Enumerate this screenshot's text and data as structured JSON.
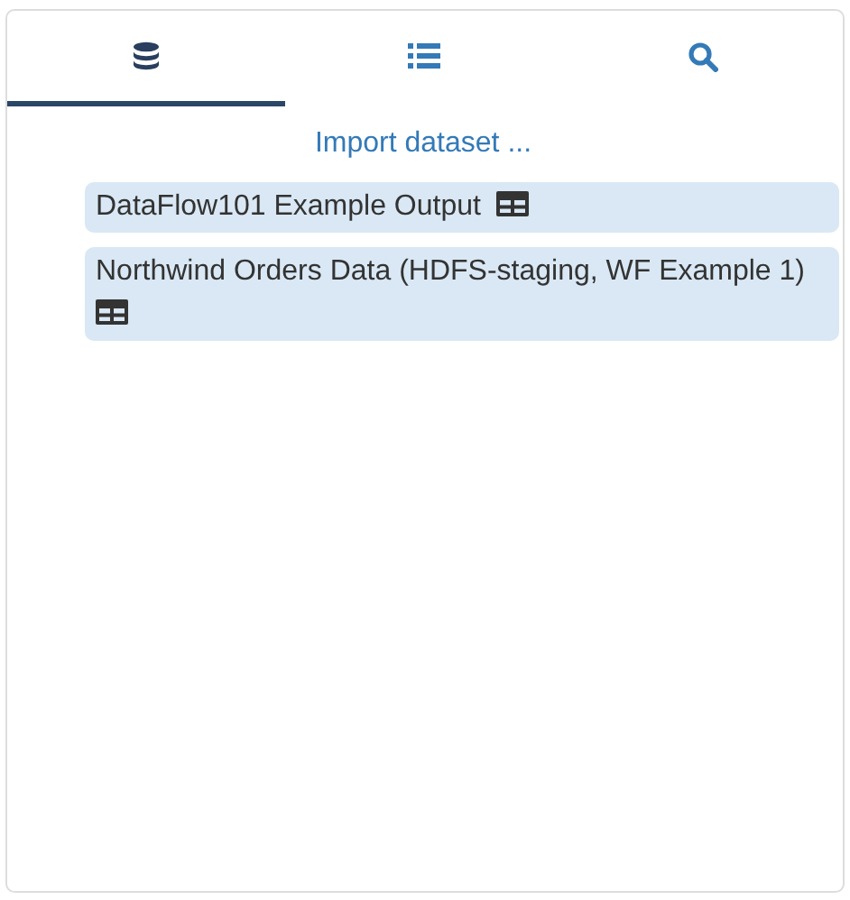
{
  "tabs": [
    {
      "kind": "database",
      "selected": true
    },
    {
      "kind": "list",
      "selected": false
    },
    {
      "kind": "search",
      "selected": false
    }
  ],
  "import_link": "Import dataset ...",
  "datasets": [
    {
      "name": "DataFlow101 Example Output"
    },
    {
      "name": "Northwind Orders Data (HDFS-staging, WF Example 1)"
    }
  ]
}
